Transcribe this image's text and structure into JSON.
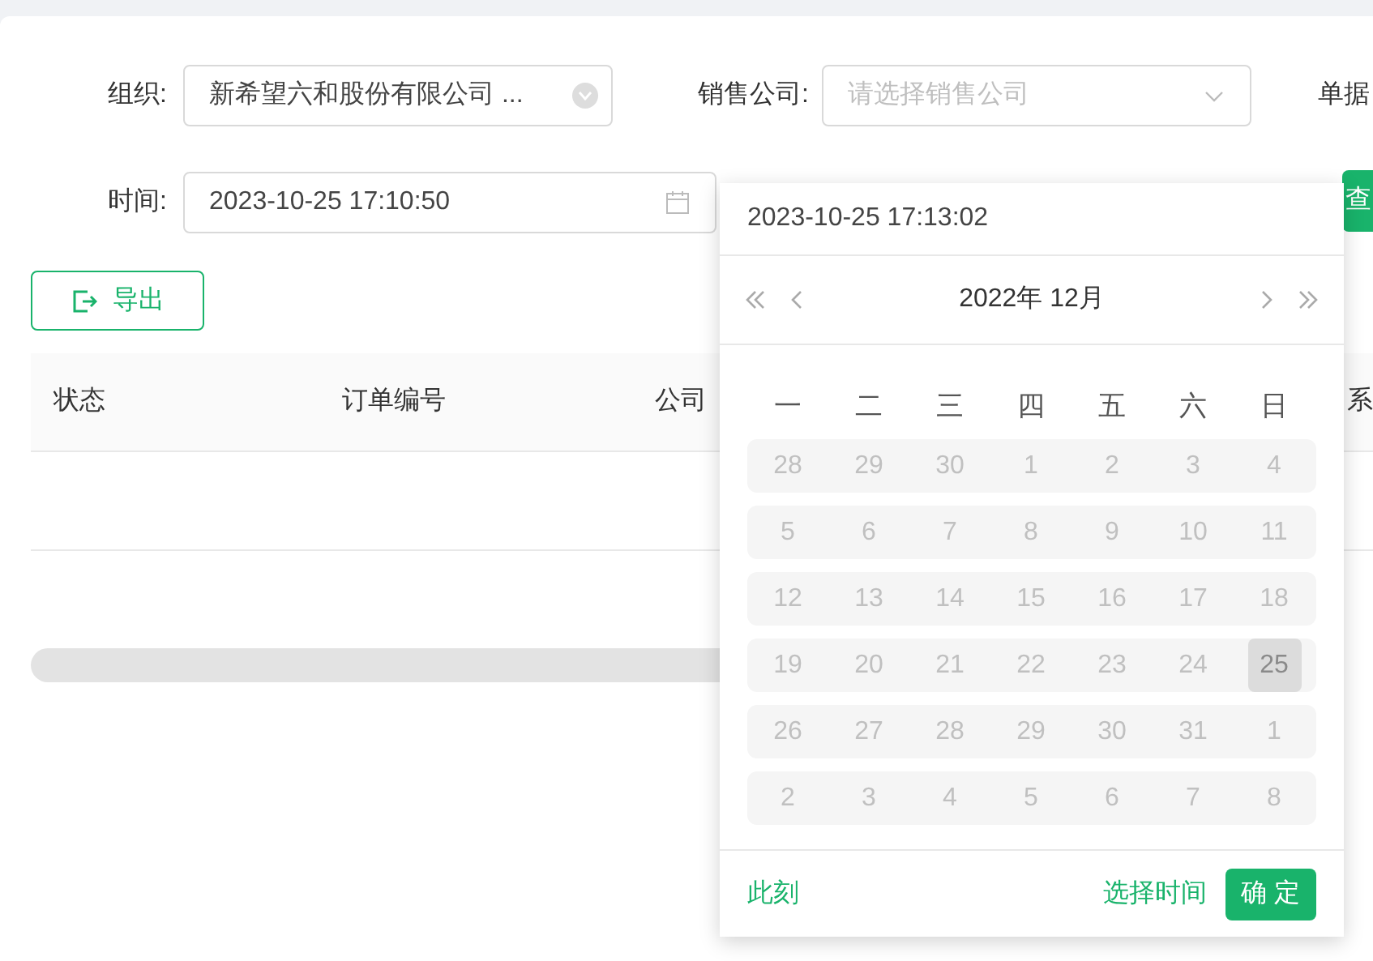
{
  "filters": [
    {
      "label": "组织:",
      "value": "新希望六和股份有限公司 ...",
      "kind": "select-clear"
    },
    {
      "label": "销售公司:",
      "placeholder": "请选择销售公司",
      "kind": "select"
    },
    {
      "label": "单据",
      "kind": "cut"
    }
  ],
  "time_filter": {
    "label": "时间:",
    "start": "2023-10-25 17:10:50"
  },
  "query_button": "查",
  "export_button": "导出",
  "table": {
    "columns": [
      "状态",
      "订单编号",
      "公司",
      "系"
    ]
  },
  "picker": {
    "time_value": "2023-10-25 17:13:02",
    "month_label": "2022年 12月",
    "weekdays": [
      "一",
      "二",
      "三",
      "四",
      "五",
      "六",
      "日"
    ],
    "weeks": [
      [
        {
          "label": "28",
          "disabled": true,
          "today": false
        },
        {
          "label": "29",
          "disabled": true,
          "today": false
        },
        {
          "label": "30",
          "disabled": true,
          "today": false
        },
        {
          "label": "1",
          "disabled": true,
          "today": false
        },
        {
          "label": "2",
          "disabled": true,
          "today": false
        },
        {
          "label": "3",
          "disabled": true,
          "today": false
        },
        {
          "label": "4",
          "disabled": true,
          "today": false
        }
      ],
      [
        {
          "label": "5",
          "disabled": true,
          "today": false
        },
        {
          "label": "6",
          "disabled": true,
          "today": false
        },
        {
          "label": "7",
          "disabled": true,
          "today": false
        },
        {
          "label": "8",
          "disabled": true,
          "today": false
        },
        {
          "label": "9",
          "disabled": true,
          "today": false
        },
        {
          "label": "10",
          "disabled": true,
          "today": false
        },
        {
          "label": "11",
          "disabled": true,
          "today": false
        }
      ],
      [
        {
          "label": "12",
          "disabled": true,
          "today": false
        },
        {
          "label": "13",
          "disabled": true,
          "today": false
        },
        {
          "label": "14",
          "disabled": true,
          "today": false
        },
        {
          "label": "15",
          "disabled": true,
          "today": false
        },
        {
          "label": "16",
          "disabled": true,
          "today": false
        },
        {
          "label": "17",
          "disabled": true,
          "today": false
        },
        {
          "label": "18",
          "disabled": true,
          "today": false
        }
      ],
      [
        {
          "label": "19",
          "disabled": true,
          "today": false
        },
        {
          "label": "20",
          "disabled": true,
          "today": false
        },
        {
          "label": "21",
          "disabled": true,
          "today": false
        },
        {
          "label": "22",
          "disabled": true,
          "today": false
        },
        {
          "label": "23",
          "disabled": true,
          "today": false
        },
        {
          "label": "24",
          "disabled": true,
          "today": false
        },
        {
          "label": "25",
          "disabled": true,
          "today": true
        }
      ],
      [
        {
          "label": "26",
          "disabled": true,
          "today": false
        },
        {
          "label": "27",
          "disabled": true,
          "today": false
        },
        {
          "label": "28",
          "disabled": true,
          "today": false
        },
        {
          "label": "29",
          "disabled": true,
          "today": false
        },
        {
          "label": "30",
          "disabled": true,
          "today": false
        },
        {
          "label": "31",
          "disabled": true,
          "today": false
        },
        {
          "label": "1",
          "disabled": true,
          "today": false
        }
      ],
      [
        {
          "label": "2",
          "disabled": true,
          "today": false
        },
        {
          "label": "3",
          "disabled": true,
          "today": false
        },
        {
          "label": "4",
          "disabled": true,
          "today": false
        },
        {
          "label": "5",
          "disabled": true,
          "today": false
        },
        {
          "label": "6",
          "disabled": true,
          "today": false
        },
        {
          "label": "7",
          "disabled": true,
          "today": false
        },
        {
          "label": "8",
          "disabled": true,
          "today": false
        }
      ]
    ],
    "now_link": "此刻",
    "select_time_link": "选择时间",
    "ok_button": "确 定"
  }
}
